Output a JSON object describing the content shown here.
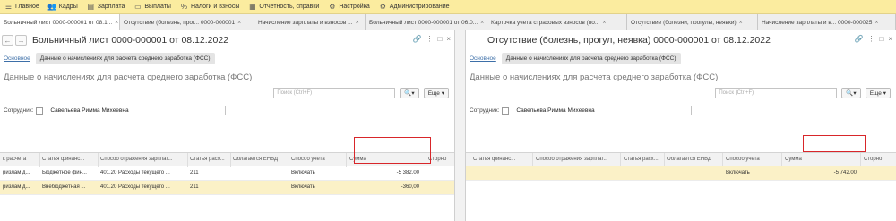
{
  "topmenu": {
    "items": [
      {
        "label": "Главное",
        "icon": "grid-icon"
      },
      {
        "label": "Кадры",
        "icon": "people-icon"
      },
      {
        "label": "Зарплата",
        "icon": "document-icon"
      },
      {
        "label": "Выплаты",
        "icon": "wallet-icon"
      },
      {
        "label": "Налоги и взносы",
        "icon": "percent-icon"
      },
      {
        "label": "Отчетность, справки",
        "icon": "report-icon"
      },
      {
        "label": "Настройка",
        "icon": "gear-icon"
      },
      {
        "label": "Администрирование",
        "icon": "gear-icon"
      }
    ]
  },
  "tabs": [
    {
      "label": "Больничный лист 0000-000001 от 08.1..."
    },
    {
      "label": "Отсутствие (болезнь, прог... 0000-000001"
    },
    {
      "label": "Начисление зарплаты и взносов ..."
    },
    {
      "label": "Больничный лист 0000-000001 от 06.0..."
    },
    {
      "label": "Карточка учета страховых взносов (по..."
    },
    {
      "label": "Отсутствие (болезни, прогулы, неявки)"
    },
    {
      "label": "Начисление зарплаты и в... 0000-000025"
    }
  ],
  "left": {
    "title": "Больничный лист 0000-000001 от 08.12.2022",
    "link_main": "Основное",
    "selected_tab": "Данные о начислениях для расчета среднего заработка (ФСС)",
    "section": "Данные о начислениях для расчета среднего заработка (ФСС)",
    "search_placeholder": "Поиск (Ctrl+F)",
    "more": "Еще",
    "employee_label": "Сотрудник:",
    "employee": "Савельева Римма Михеевна",
    "columns": [
      "к расчета",
      "Статья финанс...",
      "Способ отражения зарплат...",
      "Статья расх...",
      "Облагается ЕНВД",
      "Способ учета",
      "Сумма",
      "Сторно"
    ],
    "rows": [
      {
        "c0": "ризлам д...",
        "c1": "Бюджетное фин...",
        "c2": "401.20 Расходы текущего ...",
        "c3": "211",
        "c4": "",
        "c5": "Включать",
        "sum": "-5 382,00",
        "c7": ""
      },
      {
        "c0": "ризлам д...",
        "c1": "Внебюджетная ...",
        "c2": "401.20 Расходы текущего ...",
        "c3": "211",
        "c4": "",
        "c5": "Включать",
        "sum": "-360,00",
        "c7": ""
      }
    ]
  },
  "right": {
    "title": "Отсутствие (болезнь, прогул, неявка) 0000-000001 от 08.12.2022",
    "link_main": "Основное",
    "selected_tab": "Данные о начислениях для расчета среднего заработка (ФСС)",
    "section": "Данные о начислениях для расчета среднего заработка (ФСС)",
    "search_placeholder": "Поиск (Ctrl+F)",
    "more": "Еще",
    "employee_label": "Сотрудник:",
    "employee": "Савельева Римма Михеевна",
    "columns": [
      "Статья финанс...",
      "Способ отражения зарплат...",
      "Статья расх...",
      "Облагается ЕНВД",
      "Способ учета",
      "Сумма",
      "Сторно"
    ],
    "rows": [
      {
        "c0": "",
        "c1": "",
        "c2": "",
        "c3": "",
        "c4": "Включать",
        "sum": "-5 742,00",
        "c6": ""
      }
    ]
  }
}
